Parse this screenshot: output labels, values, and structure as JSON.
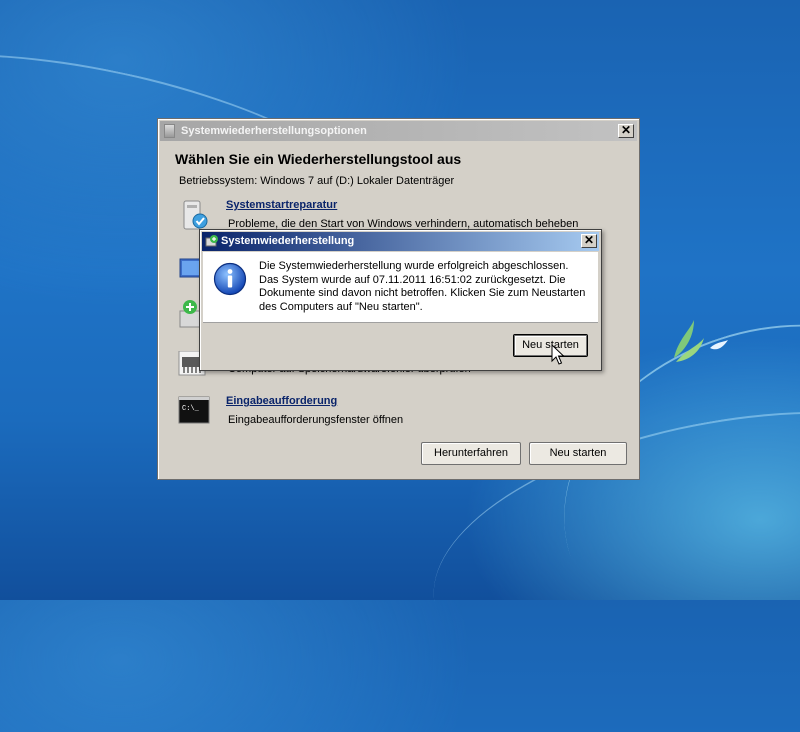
{
  "main_window": {
    "title": "Systemwiederherstellungsoptionen",
    "close_symbol": "✕",
    "heading": "Wählen Sie ein Wiederherstellungstool aus",
    "os_line": "Betriebssystem: Windows 7 auf (D:) Lokaler Datenträger",
    "tools": [
      {
        "name": "Systemstartreparatur",
        "description": "Probleme, die den Start von Windows verhindern, automatisch beheben",
        "icon": "startup-repair-icon"
      },
      {
        "name": "",
        "description": "",
        "icon": "system-restore-icon"
      },
      {
        "name": "",
        "description": "",
        "icon": "image-recovery-icon"
      },
      {
        "name": "",
        "description": "Computer auf Speicherhardwarefehler überprüfen",
        "icon": "memory-diagnostic-icon"
      },
      {
        "name": "Eingabeaufforderung",
        "description": "Eingabeaufforderungsfenster öffnen",
        "icon": "command-prompt-icon"
      }
    ],
    "buttons": {
      "shutdown": "Herunterfahren",
      "restart": "Neu starten"
    }
  },
  "dialog": {
    "title": "Systemwiederherstellung",
    "close_symbol": "✕",
    "message": "Die Systemwiederherstellung wurde erfolgreich abgeschlossen. Das System wurde auf 07.11.2011 16:51:02 zurückgesetzt. Die Dokumente sind davon nicht betroffen. Klicken Sie zum Neustarten des Computers auf \"Neu starten\".",
    "icon": "info-icon",
    "button": "Neu starten"
  },
  "colors": {
    "dialog_title_start": "#0a246a",
    "dialog_title_end": "#a6caf0",
    "link": "#0a246a"
  }
}
